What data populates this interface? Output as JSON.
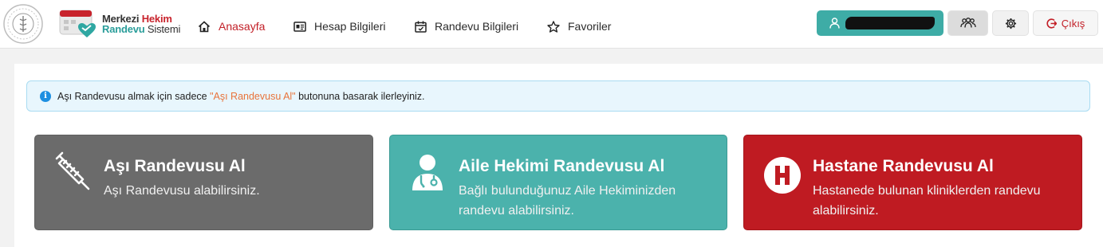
{
  "header": {
    "brand": {
      "line1_a": "Merkezi ",
      "line1_b": "Hekim",
      "line2_a": "Randevu",
      "line2_b": " Sistemi"
    },
    "nav": [
      {
        "label": "Anasayfa",
        "icon": "home-icon",
        "active": true
      },
      {
        "label": "Hesap Bilgileri",
        "icon": "id-card-icon",
        "active": false
      },
      {
        "label": "Randevu Bilgileri",
        "icon": "calendar-icon",
        "active": false
      },
      {
        "label": "Favoriler",
        "icon": "star-icon",
        "active": false
      }
    ],
    "user_icon": "user-icon",
    "exit_label": "Çıkış"
  },
  "alert": {
    "text_before": "Aşı Randevusu almak için sadece ",
    "highlight": "\"Aşı Randevusu Al\"",
    "text_after": " butonuna basarak ilerleyiniz."
  },
  "tiles": [
    {
      "title": "Aşı Randevusu Al",
      "desc": "Aşı Randevusu alabilirsiniz.",
      "icon": "syringe-icon",
      "color": "#6b6b6b"
    },
    {
      "title": "Aile Hekimi Randevusu Al",
      "desc": "Bağlı bulunduğunuz Aile Hekiminizden randevu alabilirsiniz.",
      "icon": "doctor-icon",
      "color": "#4bb2ac"
    },
    {
      "title": "Hastane Randevusu Al",
      "desc": "Hastanede bulunan kliniklerden randevu alabilirsiniz.",
      "icon": "hospital-icon",
      "color": "#bf1b22"
    }
  ]
}
